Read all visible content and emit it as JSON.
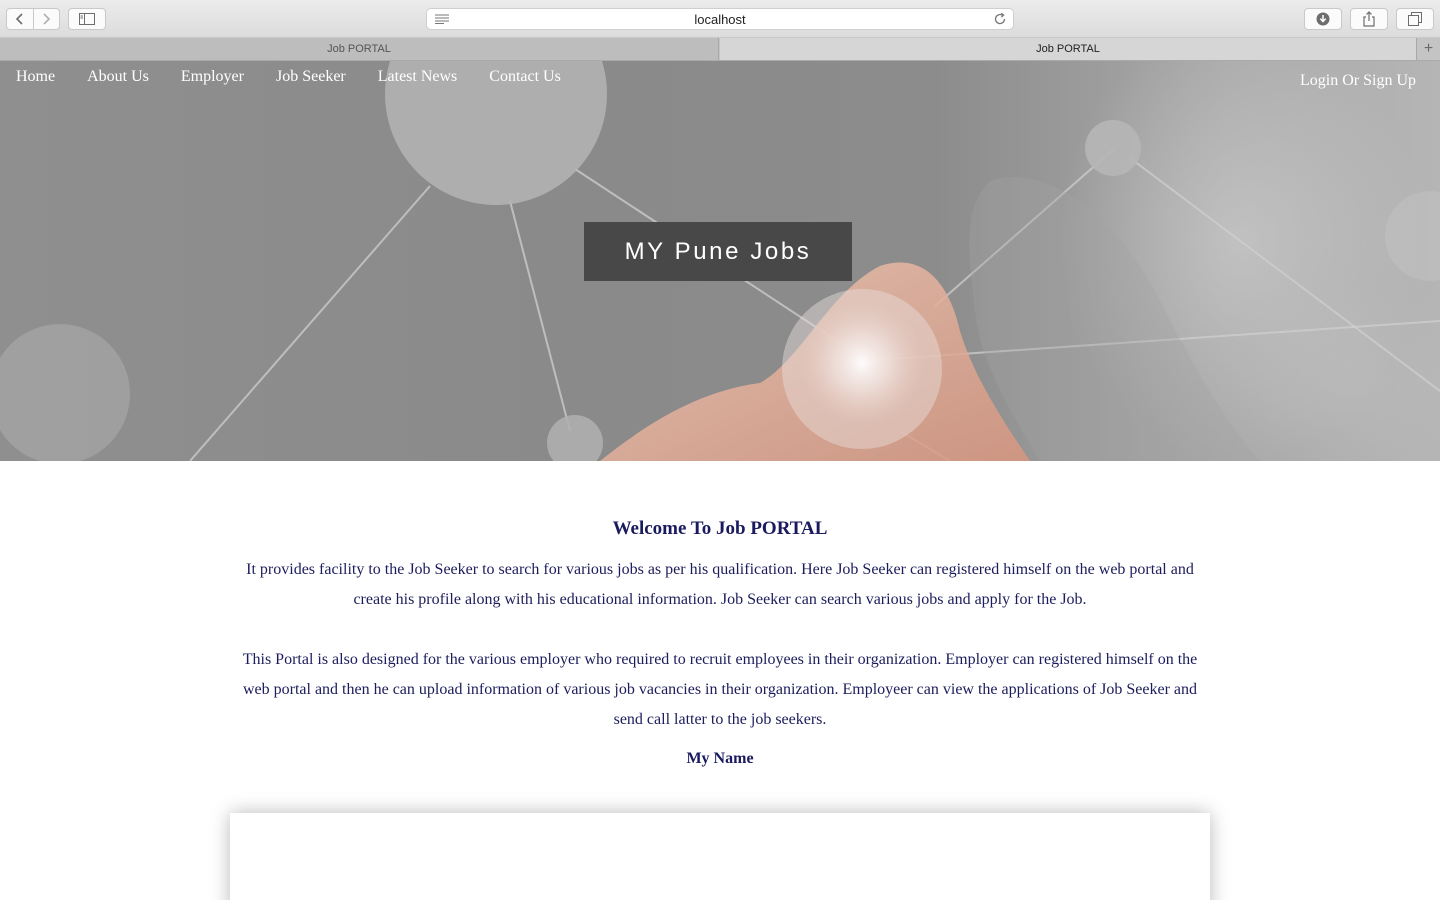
{
  "browser": {
    "url": "localhost",
    "tabs": [
      {
        "label": "Job PORTAL",
        "active": false
      },
      {
        "label": "Job PORTAL",
        "active": true
      }
    ],
    "new_tab_glyph": "+",
    "icons": [
      "back-icon",
      "forward-icon",
      "sidebar-icon",
      "reader-icon",
      "reload-icon",
      "download-icon",
      "share-icon",
      "tabs-overview-icon",
      "new-tab-icon"
    ]
  },
  "nav": {
    "items": [
      "Home",
      "About Us",
      "Employer",
      "Job Seeker",
      "Latest News",
      "Contact Us"
    ],
    "login": "Login Or Sign Up"
  },
  "hero": {
    "title": "MY Pune Jobs"
  },
  "content": {
    "heading": "Welcome To Job PORTAL",
    "paragraphs": [
      "It provides facility to the Job Seeker to search for various jobs as per his qualification. Here Job Seeker can registered himself on the web portal and create his profile along with his educational information. Job Seeker can search various jobs and apply for the Job.",
      "This Portal is also designed for the various employer who required to recruit employees in their organization. Employer can registered himself on the web portal and then he can upload information of various job vacancies in their organization. Employeer can view the applications of Job Seeker and send call latter to the job seekers."
    ],
    "my_name": "My Name"
  },
  "colors": {
    "text_primary": "#1c1c5c",
    "hero_title_bg": "#484848",
    "nav_text": "#ffffff"
  }
}
